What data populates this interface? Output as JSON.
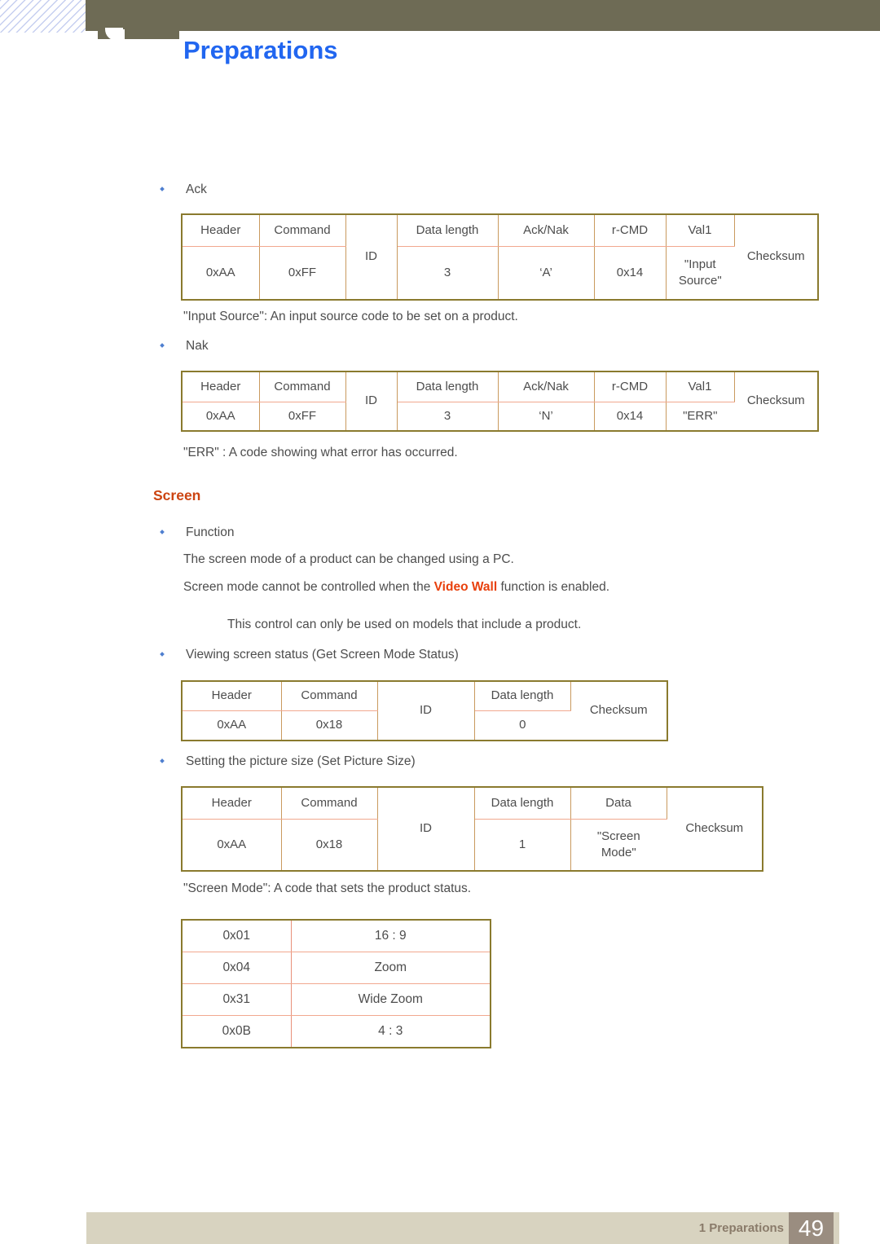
{
  "header": {
    "chapter_title": "Preparations"
  },
  "body": {
    "ack_label": "Ack",
    "input_source_note": "\"Input Source\": An input source code to be set on a product.",
    "nak_label": "Nak",
    "err_note": "\"ERR\" : A code showing what error has occurred.",
    "screen_heading": "Screen",
    "function_label": "Function",
    "function_line1": "The screen mode of a product can be changed using a PC.",
    "function_line2_pre": "Screen mode cannot be controlled when the ",
    "function_line2_accent": "Video Wall",
    "function_line2_post": " function is enabled.",
    "note_line": "This control can only be used on models that include a product.",
    "get_status_label": "Viewing screen status (Get Screen Mode Status)",
    "set_size_label": "Setting the picture size (Set Picture Size)",
    "screen_mode_note": "\"Screen Mode\": A code that sets the product status."
  },
  "tables": {
    "ack": {
      "headers": [
        "Header",
        "Command",
        "ID",
        "Data length",
        "Ack/Nak",
        "r-CMD",
        "Val1",
        "Checksum"
      ],
      "values": [
        "0xAA",
        "0xFF",
        "ID",
        "3",
        "‘A’",
        "0x14",
        "\"Input Source\"",
        "Checksum"
      ],
      "val1_line1": "\"Input",
      "val1_line2": "Source\""
    },
    "nak": {
      "headers": [
        "Header",
        "Command",
        "ID",
        "Data length",
        "Ack/Nak",
        "r-CMD",
        "Val1",
        "Checksum"
      ],
      "values": [
        "0xAA",
        "0xFF",
        "ID",
        "3",
        "‘N’",
        "0x14",
        "\"ERR\"",
        "Checksum"
      ]
    },
    "get_screen_mode": {
      "headers": [
        "Header",
        "Command",
        "ID",
        "Data length",
        "Checksum"
      ],
      "values": [
        "0xAA",
        "0x18",
        "ID",
        "0",
        "Checksum"
      ]
    },
    "set_picture_size": {
      "headers": [
        "Header",
        "Command",
        "ID",
        "Data length",
        "Data",
        "Checksum"
      ],
      "values": [
        "0xAA",
        "0x18",
        "ID",
        "1",
        "\"Screen Mode\"",
        "Checksum"
      ],
      "data_line1": "\"Screen",
      "data_line2": "Mode\""
    },
    "screen_mode_codes": {
      "rows": [
        {
          "code": "0x01",
          "name": "16 : 9"
        },
        {
          "code": "0x04",
          "name": "Zoom"
        },
        {
          "code": "0x31",
          "name": "Wide Zoom"
        },
        {
          "code": "0x0B",
          "name": "4 : 3"
        }
      ]
    }
  },
  "footer": {
    "chapter_label": "1 Preparations",
    "page_number": "49"
  },
  "colors": {
    "header_bar": "#6e6b55",
    "title_blue": "#2166f0",
    "section_orange": "#cc4411",
    "accent_orange": "#e8400c",
    "table_outer_border": "#8a7a2e",
    "table_inner_border": "#f1a88f",
    "footer_bar": "#d8d3c0",
    "page_box": "#9a8d80"
  }
}
